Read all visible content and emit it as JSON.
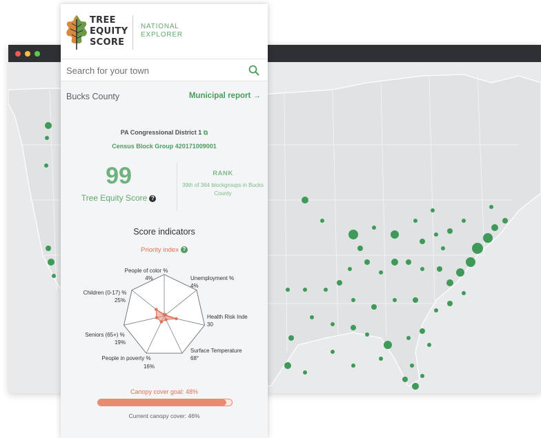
{
  "app": {
    "logo_line1": "TREE",
    "logo_line2": "EQUITY",
    "logo_line3": "SCORE",
    "sub_line1": "NATIONAL",
    "sub_line2": "EXPLORER"
  },
  "search": {
    "placeholder": "Search for your town"
  },
  "location": {
    "county": "Bucks County",
    "municipal_report": "Municipal report",
    "district": "PA Congressional District 1",
    "block_group": "Census Block Group 420171009001"
  },
  "score": {
    "value": "99",
    "label": "Tree Equity Score",
    "rank_label": "RANK",
    "rank_desc": "39th of 364 blockgroups in Bucks County"
  },
  "indicators": {
    "title": "Score indicators",
    "priority": "Priority index",
    "items": [
      {
        "name": "People of color %",
        "value": "4%",
        "fraction": 0.04
      },
      {
        "name": "Unemployment %",
        "value": "4%",
        "fraction": 0.04
      },
      {
        "name": "Health Risk Inde",
        "value": "30",
        "fraction": 0.3
      },
      {
        "name": "Surface Temperature",
        "value": "68°",
        "fraction": 0.1
      },
      {
        "name": "People in poverty %",
        "value": "16%",
        "fraction": 0.16
      },
      {
        "name": "Seniors (65+) %",
        "value": "19%",
        "fraction": 0.19
      },
      {
        "name": "Children (0-17) %",
        "value": "25%",
        "fraction": 0.25
      }
    ]
  },
  "canopy": {
    "goal_label": "Canopy cover goal: 48%",
    "current_label": "Current canopy cover: 46%",
    "current_fraction": 0.96
  },
  "colors": {
    "green": "#4e9a5f",
    "coral": "#e36f52",
    "map_cluster": "#3f9a5a",
    "map_land": "#e1e2e3"
  }
}
